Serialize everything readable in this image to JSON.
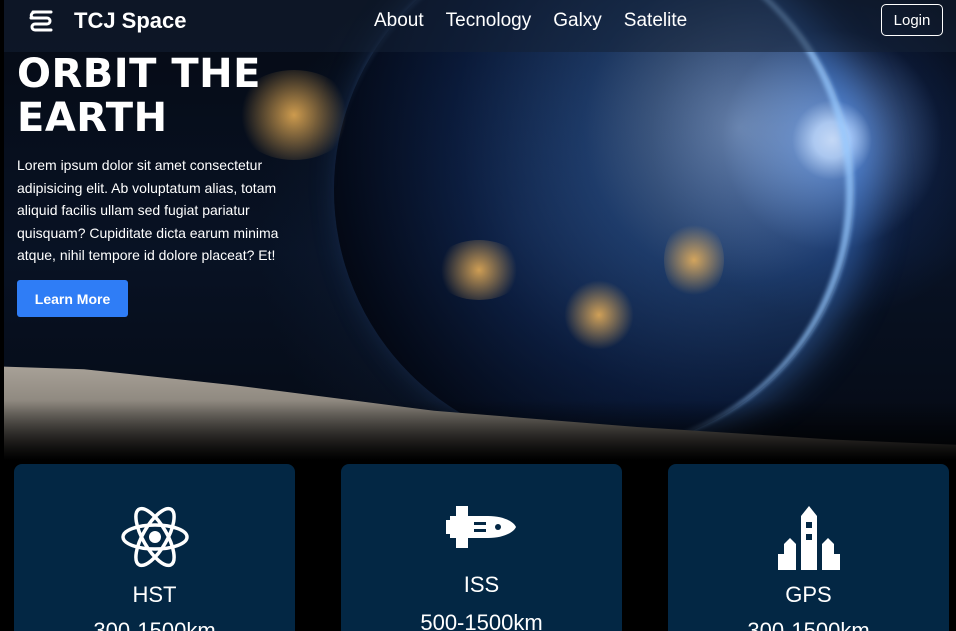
{
  "nav": {
    "brand": "TCJ Space",
    "links": [
      "About",
      "Tecnology",
      "Galxy",
      "Satelite"
    ],
    "login": "Login"
  },
  "hero": {
    "title_line1": "ORBIT THE",
    "title_line2": "EARTH",
    "description": "Lorem ipsum dolor sit amet consectetur adipisicing elit. Ab voluptatum alias, totam aliquid facilis ullam sed fugiat pariatur quisquam? Cupiditate dicta earum minima atque, nihil tempore id dolore placeat? Et!",
    "cta": "Learn More"
  },
  "cards": [
    {
      "name": "HST",
      "range": "300-1500km",
      "icon": "atom-icon"
    },
    {
      "name": "ISS",
      "range": "500-1500km",
      "icon": "space-shuttle-icon"
    },
    {
      "name": "GPS",
      "range": "300-1500km",
      "icon": "rocket-launch-icon"
    }
  ],
  "colors": {
    "accent": "#2f7df6",
    "card_bg": "#032744"
  }
}
